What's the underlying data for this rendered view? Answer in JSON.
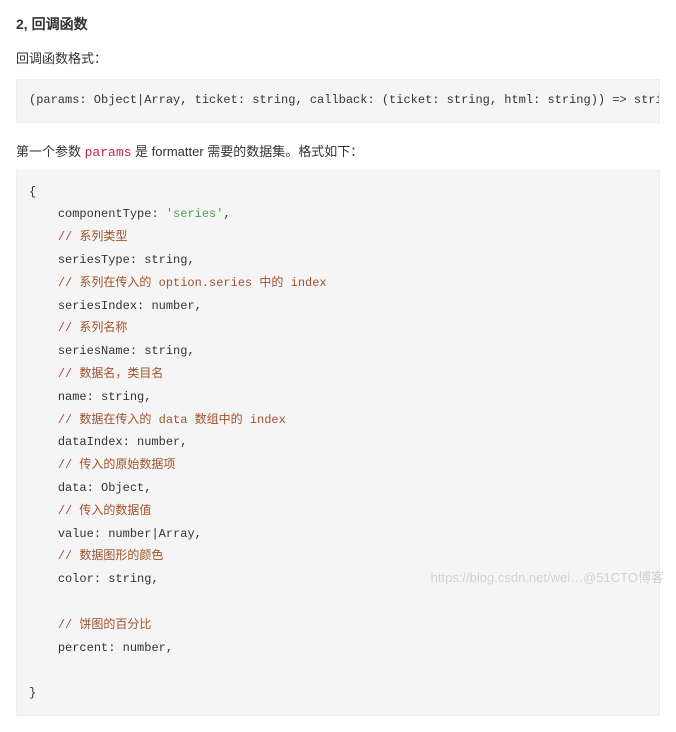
{
  "section": {
    "title": "2, 回调函数",
    "subtitle": "回调函数格式："
  },
  "signature": {
    "text": "(params: Object|Array, ticket: string, callback: (ticket: string, html: string)) => string"
  },
  "description": {
    "prefix": "第一个参数 ",
    "param_name": "params",
    "suffix": " 是 formatter 需要的数据集。格式如下："
  },
  "params_block": {
    "open": "{",
    "lines": [
      {
        "indent": 1,
        "key": "componentType",
        "sep": ": ",
        "val": "'series'",
        "val_class": "tok-string-val",
        "tail": ","
      },
      {
        "indent": 1,
        "comment": "// 系列类型"
      },
      {
        "indent": 1,
        "key": "seriesType",
        "sep": ": ",
        "val": "string",
        "val_class": "tok-param",
        "tail": ","
      },
      {
        "indent": 1,
        "comment": "// 系列在传入的 option.series 中的 index"
      },
      {
        "indent": 1,
        "key": "seriesIndex",
        "sep": ": ",
        "val": "number",
        "val_class": "tok-param",
        "tail": ","
      },
      {
        "indent": 1,
        "comment": "// 系列名称"
      },
      {
        "indent": 1,
        "key": "seriesName",
        "sep": ": ",
        "val": "string",
        "val_class": "tok-param",
        "tail": ","
      },
      {
        "indent": 1,
        "comment": "// 数据名，类目名"
      },
      {
        "indent": 1,
        "key": "name",
        "sep": ": ",
        "val": "string",
        "val_class": "tok-param",
        "tail": ","
      },
      {
        "indent": 1,
        "comment": "// 数据在传入的 data 数组中的 index"
      },
      {
        "indent": 1,
        "key": "dataIndex",
        "sep": ": ",
        "val": "number",
        "val_class": "tok-param",
        "tail": ","
      },
      {
        "indent": 1,
        "comment": "// 传入的原始数据项"
      },
      {
        "indent": 1,
        "key": "data",
        "sep": ": ",
        "val": "Object",
        "val_class": "tok-param",
        "tail": ","
      },
      {
        "indent": 1,
        "comment": "// 传入的数据值"
      },
      {
        "indent": 1,
        "key": "value",
        "sep": ": ",
        "val": "number|Array",
        "val_class": "tok-param",
        "tail": ","
      },
      {
        "indent": 1,
        "comment": "// 数据图形的颜色"
      },
      {
        "indent": 1,
        "key": "color",
        "sep": ": ",
        "val": "string",
        "val_class": "tok-param",
        "tail": ","
      },
      {
        "indent": 1,
        "blank": true
      },
      {
        "indent": 1,
        "comment": "// 饼图的百分比"
      },
      {
        "indent": 1,
        "key": "percent",
        "sep": ": ",
        "val": "number",
        "val_class": "tok-param",
        "tail": ","
      },
      {
        "indent": 1,
        "blank": true
      }
    ],
    "close": "}"
  },
  "watermark": {
    "text_left": "https://blog.csdn.net/wei…",
    "text_right": "@51CTO博客"
  }
}
